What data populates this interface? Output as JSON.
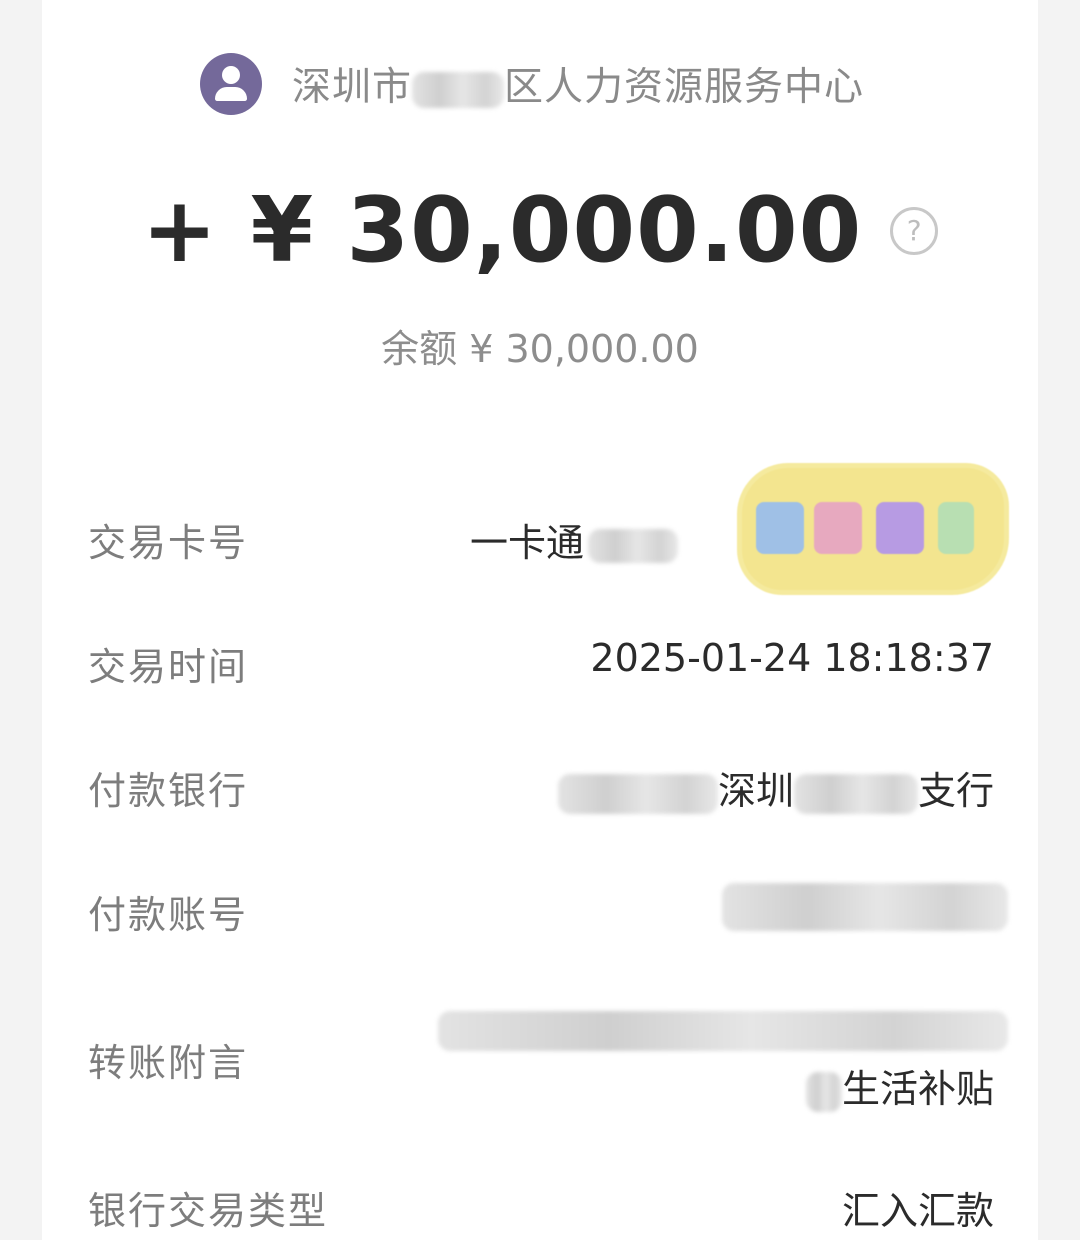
{
  "payer": {
    "name_prefix": "深圳市",
    "name_suffix": "区人力资源服务中心"
  },
  "amount": {
    "value": "+ ¥ 30,000.00",
    "help_glyph": "?"
  },
  "balance": "余额 ¥ 30,000.00",
  "details": {
    "card_no": {
      "label": "交易卡号",
      "value_prefix": "一卡通"
    },
    "time": {
      "label": "交易时间",
      "value": "2025-01-24 18:18:37"
    },
    "bank": {
      "label": "付款银行",
      "value_mid": "深圳",
      "value_suffix": "支行"
    },
    "account": {
      "label": "付款账号"
    },
    "note": {
      "label": "转账附言",
      "value_suffix": "生活补贴"
    },
    "type": {
      "label": "银行交易类型",
      "value": "汇入汇款"
    }
  },
  "colors": {
    "avatar": "#74699a",
    "sticker": "#f3e58f",
    "text_primary": "#2b2b2b",
    "text_secondary": "#7d7d7d"
  },
  "icons": [
    "person-avatar-icon",
    "question-circle-icon"
  ]
}
